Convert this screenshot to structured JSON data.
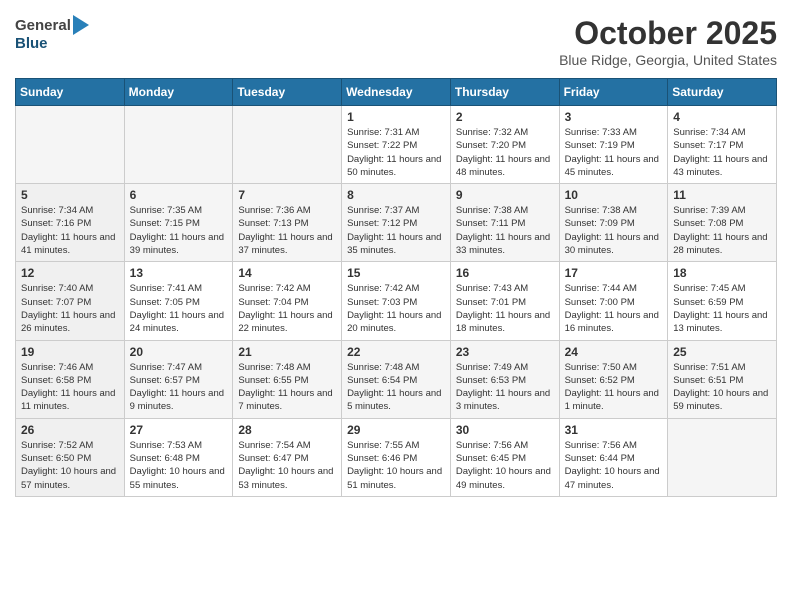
{
  "header": {
    "logo": {
      "general": "General",
      "blue": "Blue"
    },
    "title": "October 2025",
    "location": "Blue Ridge, Georgia, United States"
  },
  "weekdays": [
    "Sunday",
    "Monday",
    "Tuesday",
    "Wednesday",
    "Thursday",
    "Friday",
    "Saturday"
  ],
  "weeks": [
    [
      {
        "day": "",
        "info": ""
      },
      {
        "day": "",
        "info": ""
      },
      {
        "day": "",
        "info": ""
      },
      {
        "day": "1",
        "info": "Sunrise: 7:31 AM\nSunset: 7:22 PM\nDaylight: 11 hours and 50 minutes."
      },
      {
        "day": "2",
        "info": "Sunrise: 7:32 AM\nSunset: 7:20 PM\nDaylight: 11 hours and 48 minutes."
      },
      {
        "day": "3",
        "info": "Sunrise: 7:33 AM\nSunset: 7:19 PM\nDaylight: 11 hours and 45 minutes."
      },
      {
        "day": "4",
        "info": "Sunrise: 7:34 AM\nSunset: 7:17 PM\nDaylight: 11 hours and 43 minutes."
      }
    ],
    [
      {
        "day": "5",
        "info": "Sunrise: 7:34 AM\nSunset: 7:16 PM\nDaylight: 11 hours and 41 minutes."
      },
      {
        "day": "6",
        "info": "Sunrise: 7:35 AM\nSunset: 7:15 PM\nDaylight: 11 hours and 39 minutes."
      },
      {
        "day": "7",
        "info": "Sunrise: 7:36 AM\nSunset: 7:13 PM\nDaylight: 11 hours and 37 minutes."
      },
      {
        "day": "8",
        "info": "Sunrise: 7:37 AM\nSunset: 7:12 PM\nDaylight: 11 hours and 35 minutes."
      },
      {
        "day": "9",
        "info": "Sunrise: 7:38 AM\nSunset: 7:11 PM\nDaylight: 11 hours and 33 minutes."
      },
      {
        "day": "10",
        "info": "Sunrise: 7:38 AM\nSunset: 7:09 PM\nDaylight: 11 hours and 30 minutes."
      },
      {
        "day": "11",
        "info": "Sunrise: 7:39 AM\nSunset: 7:08 PM\nDaylight: 11 hours and 28 minutes."
      }
    ],
    [
      {
        "day": "12",
        "info": "Sunrise: 7:40 AM\nSunset: 7:07 PM\nDaylight: 11 hours and 26 minutes."
      },
      {
        "day": "13",
        "info": "Sunrise: 7:41 AM\nSunset: 7:05 PM\nDaylight: 11 hours and 24 minutes."
      },
      {
        "day": "14",
        "info": "Sunrise: 7:42 AM\nSunset: 7:04 PM\nDaylight: 11 hours and 22 minutes."
      },
      {
        "day": "15",
        "info": "Sunrise: 7:42 AM\nSunset: 7:03 PM\nDaylight: 11 hours and 20 minutes."
      },
      {
        "day": "16",
        "info": "Sunrise: 7:43 AM\nSunset: 7:01 PM\nDaylight: 11 hours and 18 minutes."
      },
      {
        "day": "17",
        "info": "Sunrise: 7:44 AM\nSunset: 7:00 PM\nDaylight: 11 hours and 16 minutes."
      },
      {
        "day": "18",
        "info": "Sunrise: 7:45 AM\nSunset: 6:59 PM\nDaylight: 11 hours and 13 minutes."
      }
    ],
    [
      {
        "day": "19",
        "info": "Sunrise: 7:46 AM\nSunset: 6:58 PM\nDaylight: 11 hours and 11 minutes."
      },
      {
        "day": "20",
        "info": "Sunrise: 7:47 AM\nSunset: 6:57 PM\nDaylight: 11 hours and 9 minutes."
      },
      {
        "day": "21",
        "info": "Sunrise: 7:48 AM\nSunset: 6:55 PM\nDaylight: 11 hours and 7 minutes."
      },
      {
        "day": "22",
        "info": "Sunrise: 7:48 AM\nSunset: 6:54 PM\nDaylight: 11 hours and 5 minutes."
      },
      {
        "day": "23",
        "info": "Sunrise: 7:49 AM\nSunset: 6:53 PM\nDaylight: 11 hours and 3 minutes."
      },
      {
        "day": "24",
        "info": "Sunrise: 7:50 AM\nSunset: 6:52 PM\nDaylight: 11 hours and 1 minute."
      },
      {
        "day": "25",
        "info": "Sunrise: 7:51 AM\nSunset: 6:51 PM\nDaylight: 10 hours and 59 minutes."
      }
    ],
    [
      {
        "day": "26",
        "info": "Sunrise: 7:52 AM\nSunset: 6:50 PM\nDaylight: 10 hours and 57 minutes."
      },
      {
        "day": "27",
        "info": "Sunrise: 7:53 AM\nSunset: 6:48 PM\nDaylight: 10 hours and 55 minutes."
      },
      {
        "day": "28",
        "info": "Sunrise: 7:54 AM\nSunset: 6:47 PM\nDaylight: 10 hours and 53 minutes."
      },
      {
        "day": "29",
        "info": "Sunrise: 7:55 AM\nSunset: 6:46 PM\nDaylight: 10 hours and 51 minutes."
      },
      {
        "day": "30",
        "info": "Sunrise: 7:56 AM\nSunset: 6:45 PM\nDaylight: 10 hours and 49 minutes."
      },
      {
        "day": "31",
        "info": "Sunrise: 7:56 AM\nSunset: 6:44 PM\nDaylight: 10 hours and 47 minutes."
      },
      {
        "day": "",
        "info": ""
      }
    ]
  ]
}
